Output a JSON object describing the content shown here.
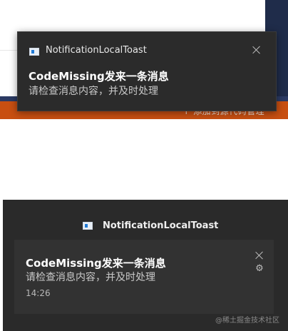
{
  "colors": {
    "toast_bg": "#2b2b2b",
    "action_center_bg": "#2a2a2a",
    "card_bg": "#323232",
    "accent_orange": "#c84f11",
    "app_icon_blue": "#1f7ad6"
  },
  "background_app": {
    "status_text": "↑ 添加到源代码管理 ⌃"
  },
  "popup_toast": {
    "app_name": "NotificationLocalToast",
    "app_icon": "app-window-icon",
    "title": "CodeMissing发来一条消息",
    "body": "请检查消息内容，并及时处理",
    "close_icon": "close-icon"
  },
  "action_center": {
    "app_name": "NotificationLocalToast",
    "app_icon": "app-window-icon",
    "notification": {
      "title": "CodeMissing发来一条消息",
      "body": "请检查消息内容，并及时处理",
      "time": "14:26",
      "close_icon": "close-icon",
      "settings_icon": "gear-icon"
    },
    "watermark": "@稀土掘金技术社区"
  }
}
